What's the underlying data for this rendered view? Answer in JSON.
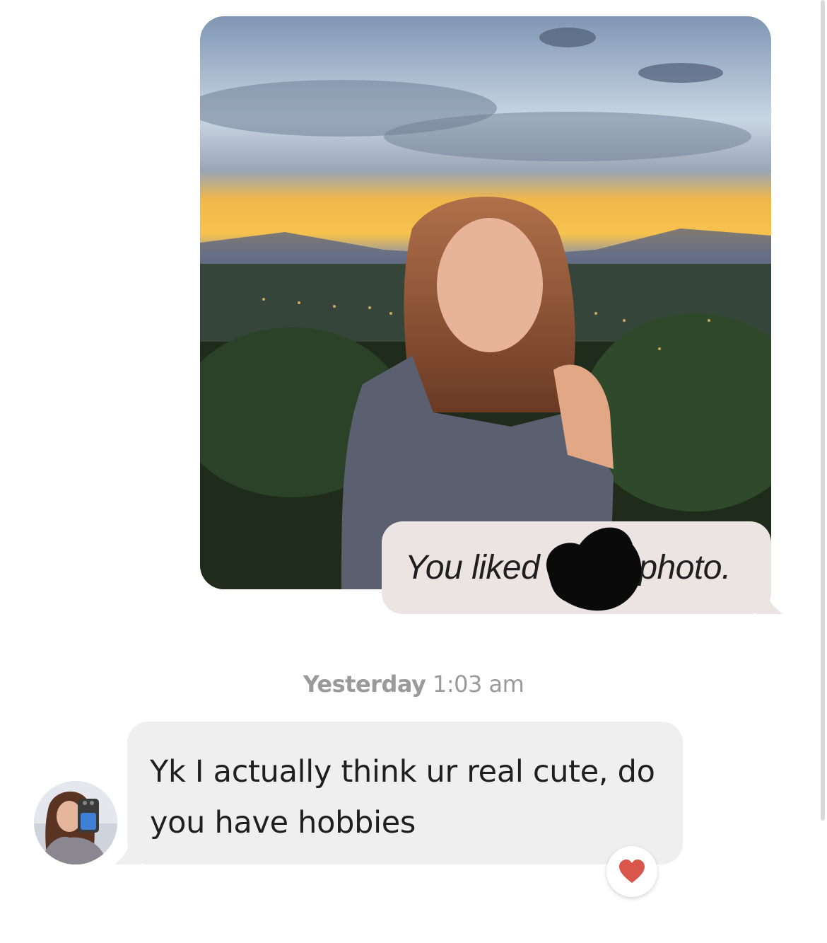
{
  "liked_notice": {
    "prefix": "You liked",
    "suffix": "photo."
  },
  "timestamp": {
    "day": "Yesterday",
    "time": "1:03 am"
  },
  "message": {
    "text": "Yk I actually think ur real cute, do you have hobbies"
  },
  "icons": {
    "reaction": "heart-icon",
    "avatar": "avatar",
    "redaction": "redaction-mark"
  },
  "colors": {
    "liked_bubble": "#ece4e2",
    "message_bubble": "#efefef",
    "heart": "#d9574a",
    "timestamp": "#9a9a9a"
  }
}
